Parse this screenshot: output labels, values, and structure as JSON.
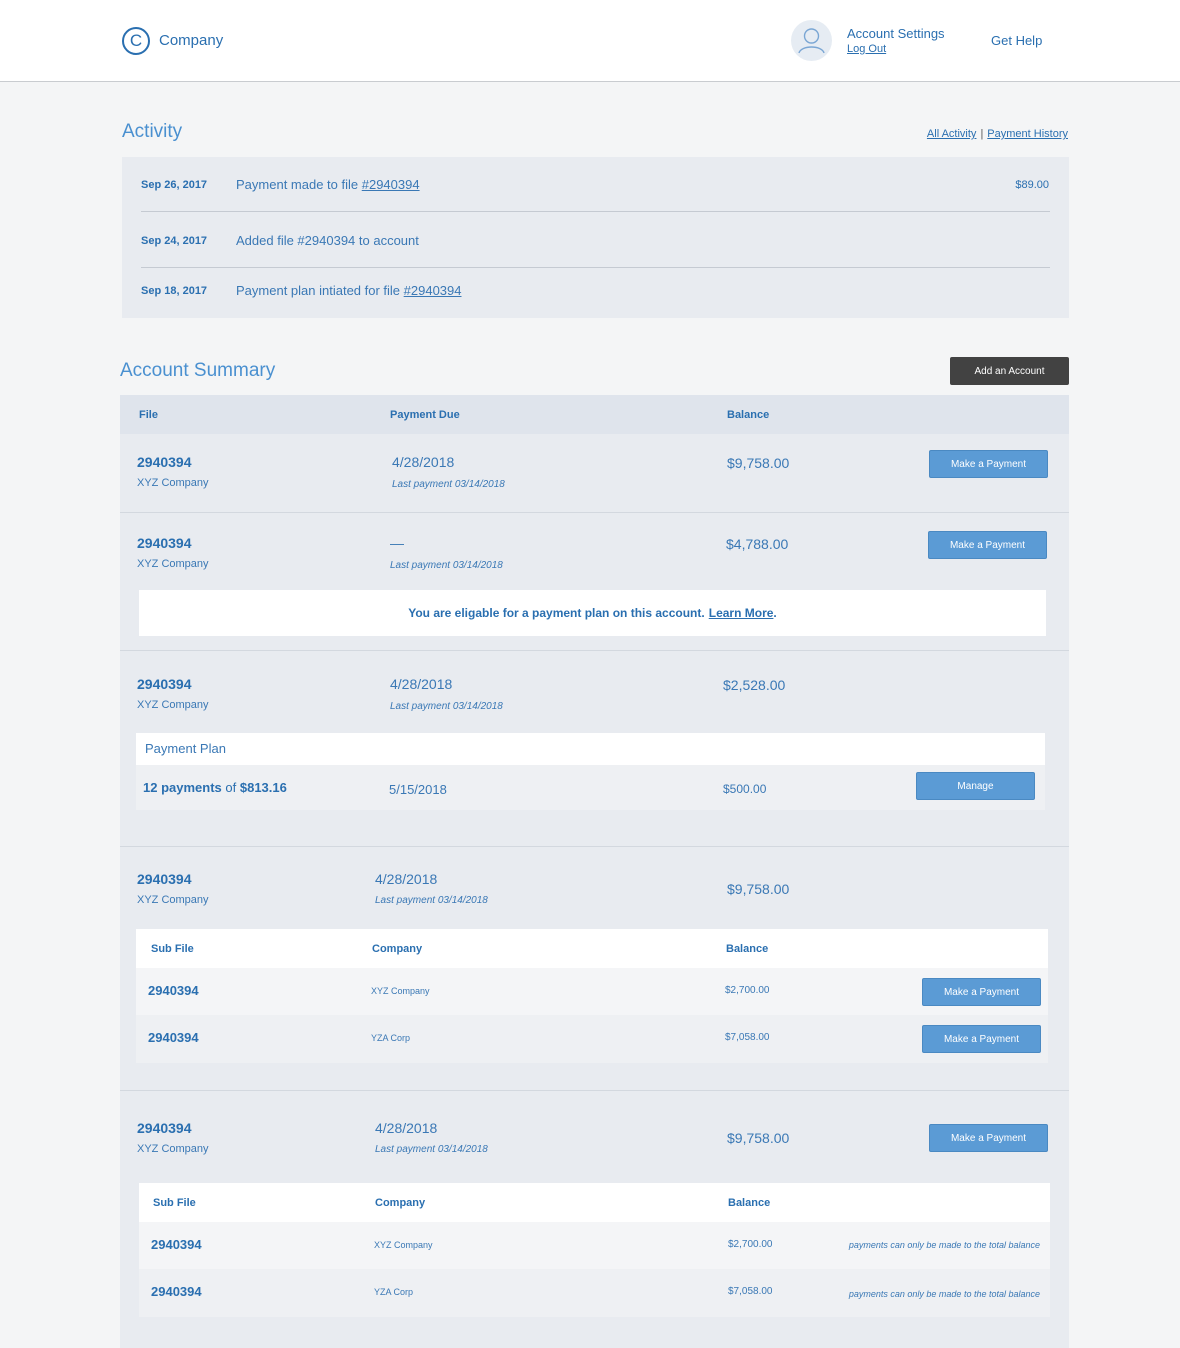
{
  "header": {
    "logo_letter": "C",
    "logo_text": "Company",
    "account_settings": "Account Settings",
    "log_out": "Log Out",
    "get_help": "Get Help"
  },
  "activity": {
    "title": "Activity",
    "links": {
      "all": "All Activity",
      "separator": "|",
      "history": "Payment History"
    },
    "items": [
      {
        "date": "Sep 26, 2017",
        "text": "Payment made to file ",
        "link": "#2940394",
        "amount": "$89.00"
      },
      {
        "date": "Sep 24, 2017",
        "text": "Added file #2940394 to account",
        "link": "",
        "amount": ""
      },
      {
        "date": "Sep 18, 2017",
        "text": "Payment plan intiated for file ",
        "link": "#2940394",
        "amount": ""
      }
    ]
  },
  "summary": {
    "title": "Account Summary",
    "add_button": "Add an Account",
    "columns": {
      "file": "File",
      "due": "Payment Due",
      "balance": "Balance"
    },
    "make_payment": "Make a Payment",
    "accounts": [
      {
        "file": "2940394",
        "company": "XYZ Company",
        "due": "4/28/2018",
        "last": "Last payment 03/14/2018",
        "balance": "$9,758.00"
      },
      {
        "file": "2940394",
        "company": "XYZ Company",
        "due": "—",
        "last": "Last payment 03/14/2018",
        "balance": "$4,788.00",
        "notice": "You are eligable for a payment plan on this account.",
        "notice_link": "Learn More",
        "notice_end": "."
      },
      {
        "file": "2940394",
        "company": "XYZ Company",
        "due": "4/28/2018",
        "last": "Last payment 03/14/2018",
        "balance": "$2,528.00",
        "plan": {
          "title": "Payment Plan",
          "count": "12 payments",
          "of": "of",
          "amount": "$813.16",
          "date": "5/15/2018",
          "due": "$500.00",
          "button": "Manage"
        }
      },
      {
        "file": "2940394",
        "company": "XYZ Company",
        "due": "4/28/2018",
        "last": "Last payment 03/14/2018",
        "balance": "$9,758.00",
        "sub_columns": {
          "file": "Sub File",
          "company": "Company",
          "balance": "Balance"
        },
        "subs": [
          {
            "file": "2940394",
            "company": "XYZ Company",
            "balance": "$2,700.00"
          },
          {
            "file": "2940394",
            "company": "YZA Corp",
            "balance": "$7,058.00"
          }
        ]
      },
      {
        "file": "2940394",
        "company": "XYZ Company",
        "due": "4/28/2018",
        "last": "Last payment 03/14/2018",
        "balance": "$9,758.00",
        "sub_columns": {
          "file": "Sub File",
          "company": "Company",
          "balance": "Balance"
        },
        "subs": [
          {
            "file": "2940394",
            "company": "XYZ Company",
            "balance": "$2,700.00",
            "note": "payments can only be made to the total balance"
          },
          {
            "file": "2940394",
            "company": "YZA Corp",
            "balance": "$7,058.00",
            "note": "payments can only be made to the total balance"
          }
        ]
      }
    ]
  },
  "colors": {
    "brand_blue": "#2a6fb0",
    "button_blue": "#5b9bd5",
    "dark_button": "#424242",
    "panel": "#e8ebf0"
  }
}
